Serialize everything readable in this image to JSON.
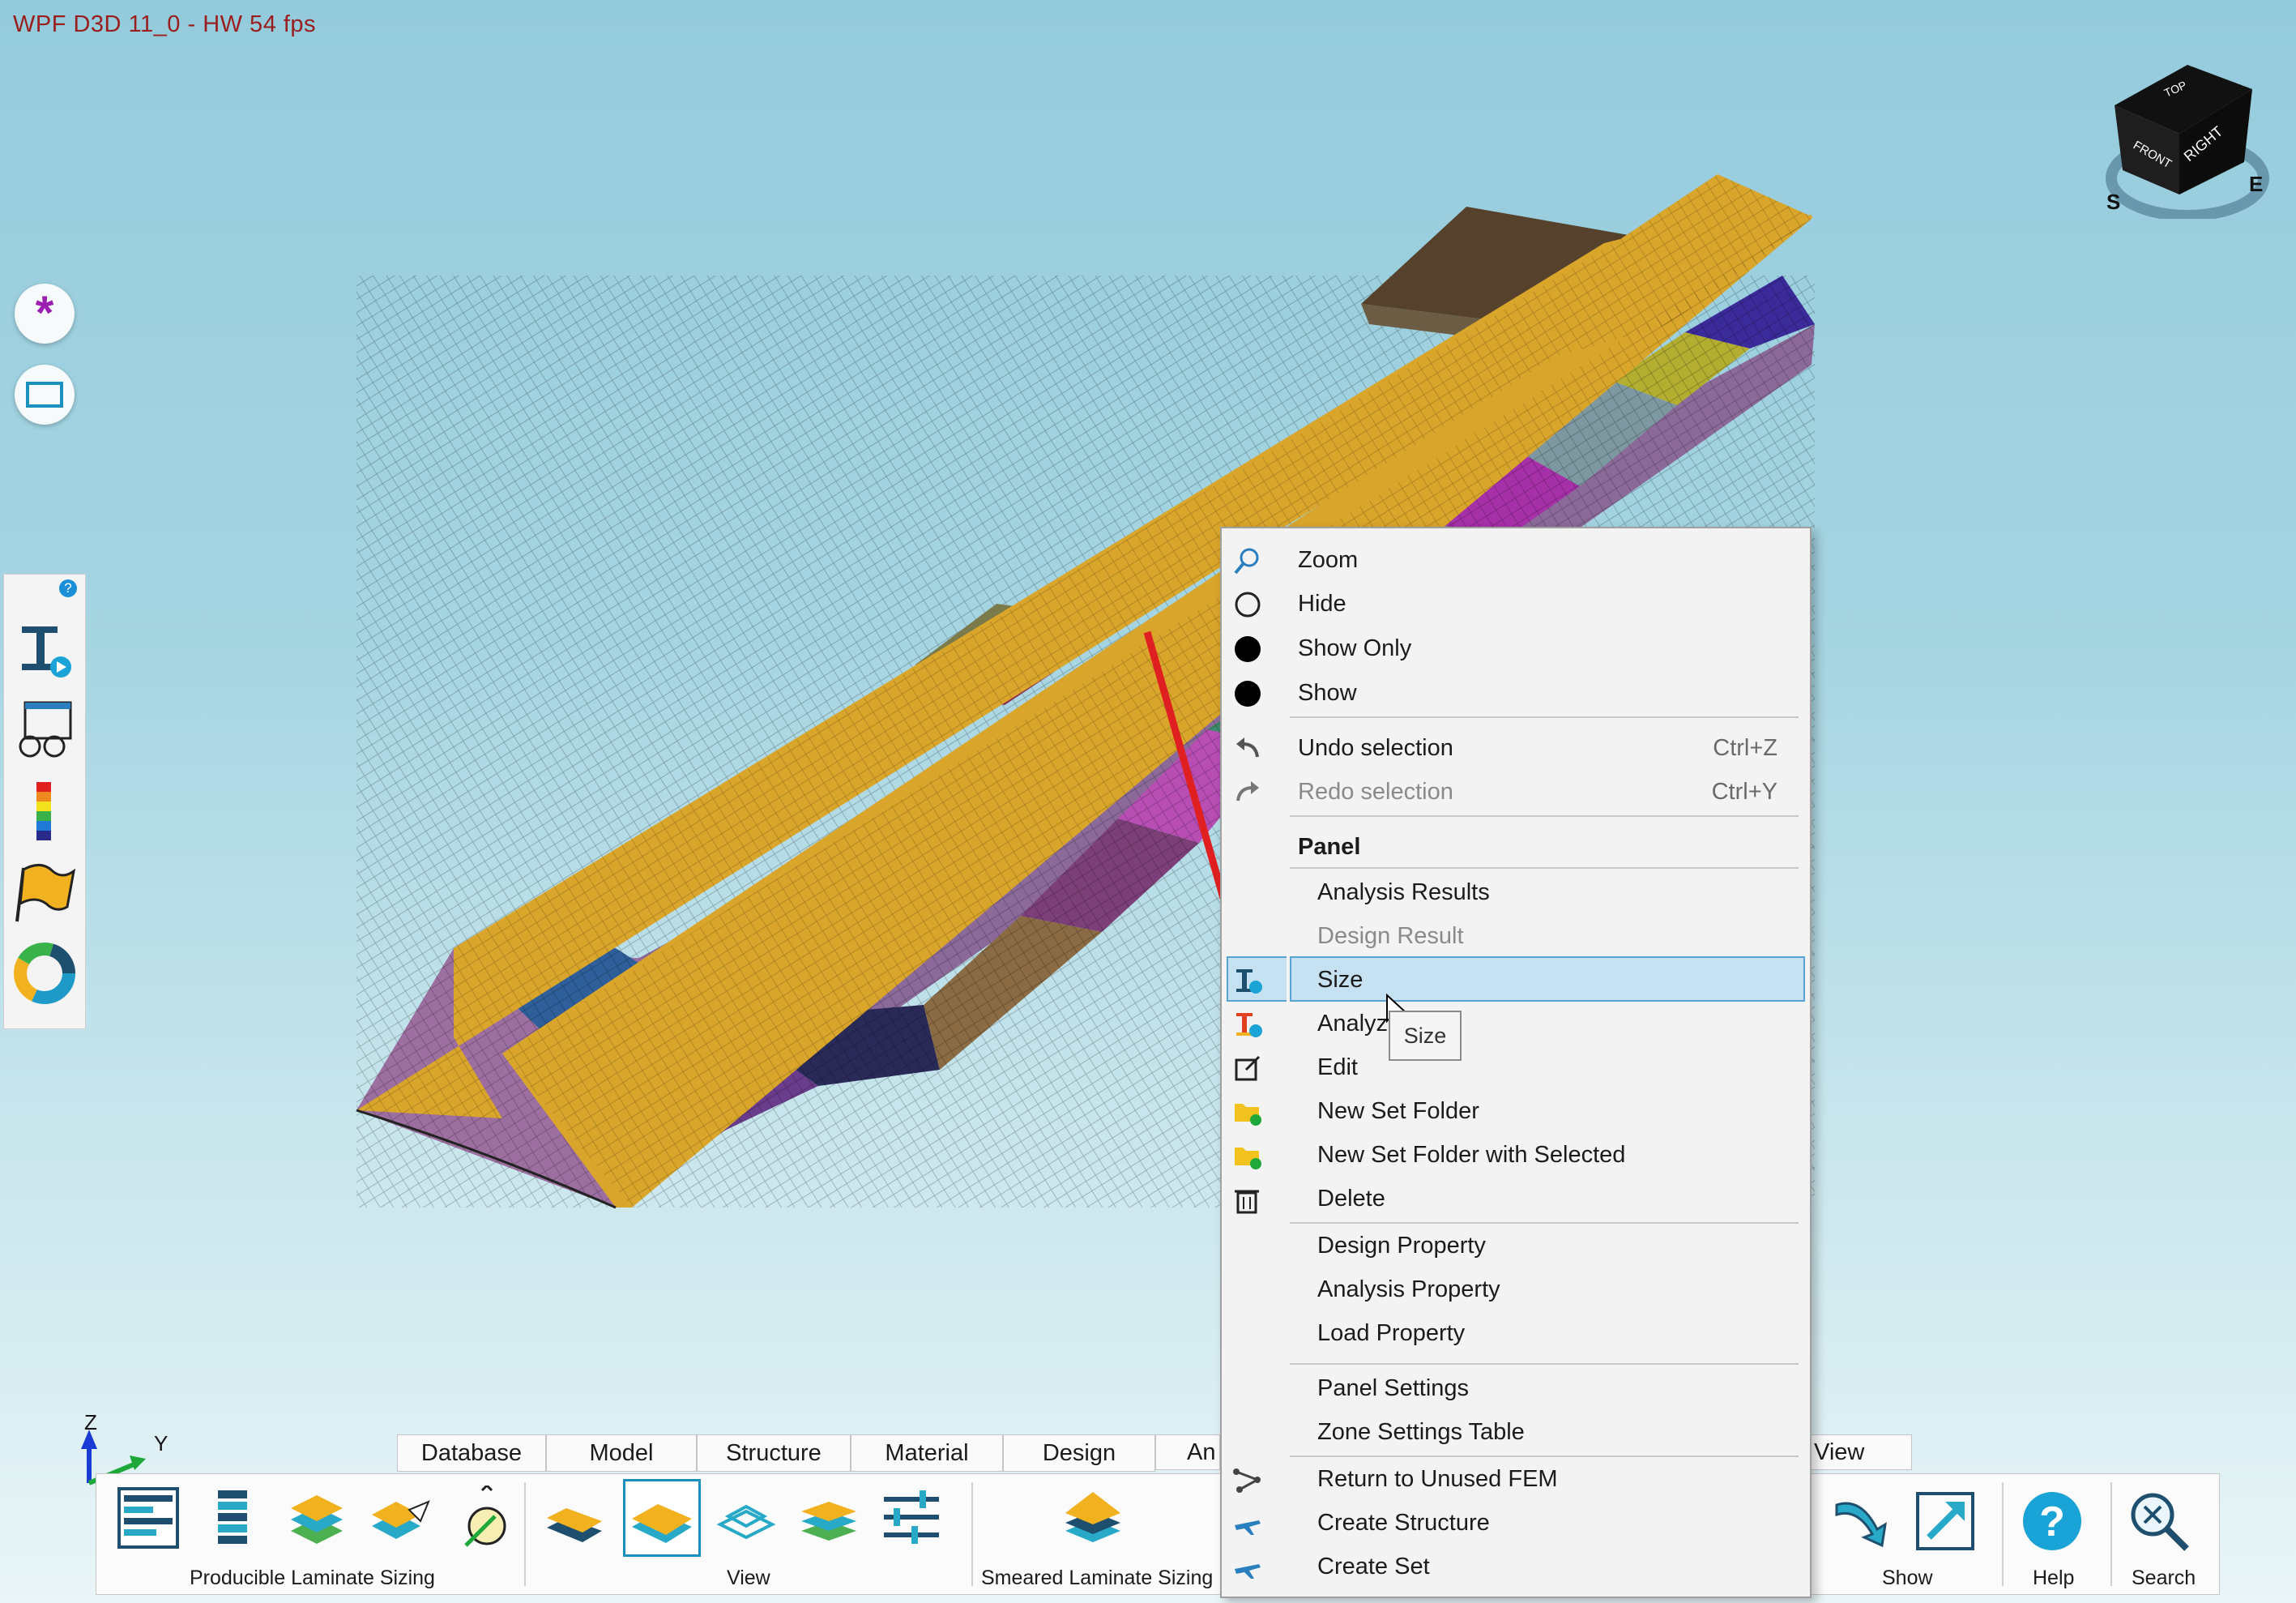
{
  "status": {
    "fps_text": "WPF D3D 11_0 - HW  54  fps"
  },
  "view_cube": {
    "top": "TOP",
    "front": "FRONT",
    "right": "RIGHT",
    "compass_s": "S",
    "compass_e": "E"
  },
  "axis_triad": {
    "z": "Z",
    "y": "Y"
  },
  "context_menu": {
    "zoom": "Zoom",
    "hide": "Hide",
    "show_only": "Show Only",
    "show": "Show",
    "undo": "Undo selection",
    "undo_shortcut": "Ctrl+Z",
    "redo": "Redo selection",
    "redo_shortcut": "Ctrl+Y",
    "section_header": "Panel",
    "analysis_results": "Analysis Results",
    "design_result": "Design Result",
    "size": "Size",
    "analyze": "Analyze",
    "edit": "Edit",
    "new_set_folder": "New Set Folder",
    "new_set_folder_selected": "New Set Folder with Selected",
    "delete": "Delete",
    "design_property": "Design Property",
    "analysis_property": "Analysis Property",
    "load_property": "Load Property",
    "panel_settings": "Panel Settings",
    "zone_settings_table": "Zone Settings Table",
    "return_unused_fem": "Return to Unused FEM",
    "create_structure": "Create Structure",
    "create_set": "Create Set"
  },
  "tooltip": "Size",
  "tabs": [
    "Database",
    "Model",
    "Structure",
    "Material",
    "Design",
    "An",
    "View"
  ],
  "ribbon": {
    "group_producible": "Producible Laminate Sizing",
    "group_view": "View",
    "group_smeared": "Smeared Laminate Sizing",
    "group_show": "Show",
    "group_help": "Help",
    "group_search": "Search"
  },
  "colors": {
    "wing_skin": "#d9a52a",
    "menu_highlight": "#c6e1f1",
    "arrow_red": "#e02020"
  }
}
